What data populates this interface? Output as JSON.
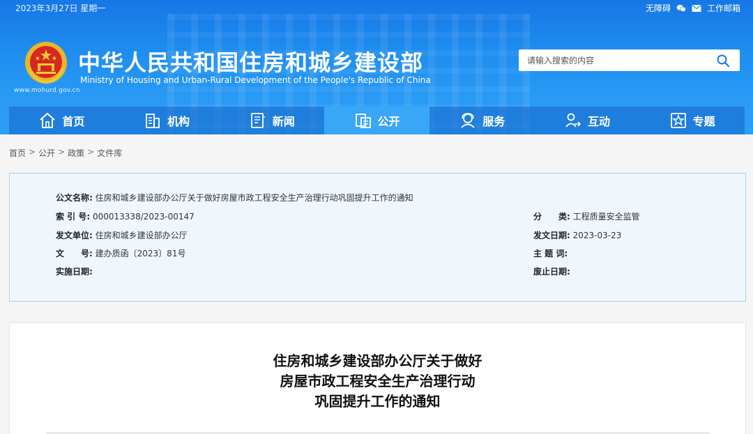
{
  "topbar": {
    "date": "2023年3月27日 星期一",
    "accessibility": "无障碍",
    "mail": "工作邮箱"
  },
  "site": {
    "title_cn": "中华人民共和国住房和城乡建设部",
    "title_en": "Ministry of Housing and Urban-Rural Development of the People's Republic of China",
    "url": "www.mohurd.gov.cn"
  },
  "search": {
    "placeholder": "请输入搜索的内容"
  },
  "nav": {
    "items": [
      {
        "label": "首页",
        "icon": "home-icon"
      },
      {
        "label": "机构",
        "icon": "building-icon"
      },
      {
        "label": "新闻",
        "icon": "news-icon"
      },
      {
        "label": "公开",
        "icon": "document-icon"
      },
      {
        "label": "服务",
        "icon": "service-icon"
      },
      {
        "label": "互动",
        "icon": "interaction-icon"
      },
      {
        "label": "专题",
        "icon": "star-icon"
      }
    ],
    "active_index": 3
  },
  "breadcrumb": [
    "首页",
    "公开",
    "政策",
    "文件库"
  ],
  "meta": {
    "doc_name_label": "公文名称:",
    "doc_name": "住房和城乡建设部办公厅关于做好房屋市政工程安全生产治理行动巩固提升工作的通知",
    "index_label": "索 引 号:",
    "index": "000013338/2023-00147",
    "category_label": "分　　类:",
    "category": "工程质量安全监管",
    "issuer_label": "发文单位:",
    "issuer": "住房和城乡建设部办公厅",
    "issue_date_label": "发文日期:",
    "issue_date": "2023-03-23",
    "doc_no_label": "文　　号:",
    "doc_no": "建办质函〔2023〕81号",
    "keywords_label": "主 题 词:",
    "keywords": "",
    "effective_label": "实施日期:",
    "effective": "",
    "abolish_label": "废止日期:",
    "abolish": ""
  },
  "article": {
    "title_line1": "住房和城乡建设部办公厅关于做好",
    "title_line2": "房屋市政工程安全生产治理行动",
    "title_line3": "巩固提升工作的通知"
  },
  "colors": {
    "header_blue": "#1f8ef0",
    "nav_active": "#3aa6f7",
    "meta_bg": "#f0f7fc",
    "meta_border": "#a8cfe9"
  }
}
